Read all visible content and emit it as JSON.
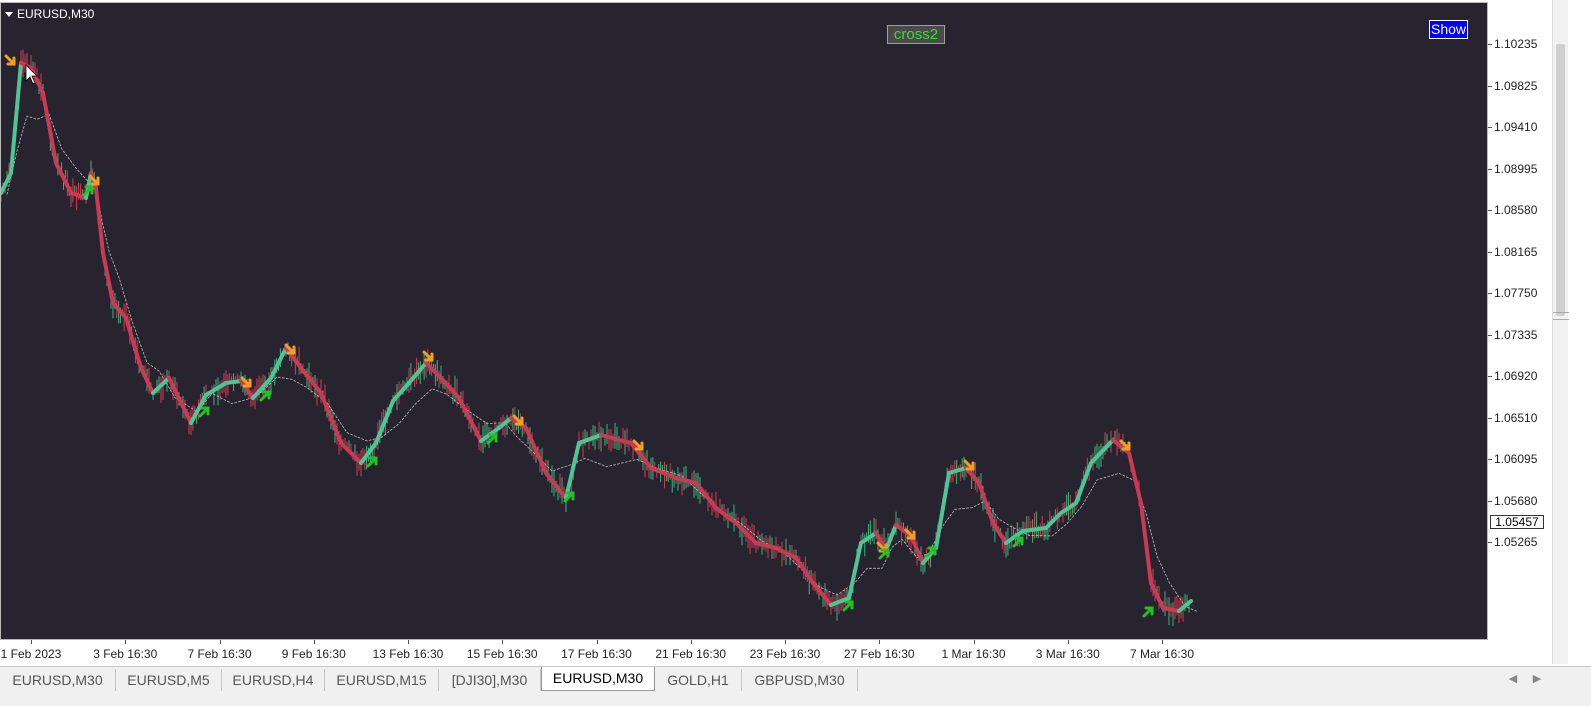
{
  "chart": {
    "symbol_title": "EURUSD,M30",
    "indicator_label": "cross2",
    "show_button": "Show",
    "current_price": "1.05457",
    "price_labels": [
      "1.10235",
      "1.09825",
      "1.09410",
      "1.08995",
      "1.08580",
      "1.08165",
      "1.07750",
      "1.07335",
      "1.06920",
      "1.06510",
      "1.06095",
      "1.05680",
      "1.05265"
    ],
    "time_labels": [
      "1 Feb 2023",
      "3 Feb 16:30",
      "7 Feb 16:30",
      "9 Feb 16:30",
      "13 Feb 16:30",
      "15 Feb 16:30",
      "17 Feb 16:30",
      "21 Feb 16:30",
      "23 Feb 16:30",
      "27 Feb 16:30",
      "1 Mar 16:30",
      "3 Mar 16:30",
      "7 Mar 16:30"
    ]
  },
  "colors": {
    "background": "#28242f",
    "up_candle": "#3ab37a",
    "down_candle": "#d23c50",
    "ma_up": "#4fc497",
    "ma_down": "#c93a55",
    "sell_arrow": "#f0a020",
    "buy_arrow": "#22c222"
  },
  "tabs": [
    {
      "label": "EURUSD,M30",
      "active": false
    },
    {
      "label": "EURUSD,M5",
      "active": false
    },
    {
      "label": "EURUSD,H4",
      "active": false
    },
    {
      "label": "EURUSD,M15",
      "active": false
    },
    {
      "label": "[DJI30],M30",
      "active": false
    },
    {
      "label": "EURUSD,M30",
      "active": true
    },
    {
      "label": "GOLD,H1",
      "active": false
    },
    {
      "label": "GBPUSD,M30",
      "active": false
    }
  ],
  "icons": {
    "title_menu": "triangle-down-icon",
    "mouse_cursor": "arrow-cursor-icon",
    "tab_prev": "tab-left-arrow-icon",
    "tab_next": "tab-right-arrow-icon"
  },
  "signals": [
    {
      "type": "sell",
      "time": "1 Feb 2023",
      "price": 1.1018
    },
    {
      "type": "buy",
      "time": "3 Feb 16:30",
      "price": 1.0898
    },
    {
      "type": "sell",
      "time": "3 Feb 16:30",
      "price": 1.0905
    },
    {
      "type": "buy",
      "time": "7 Feb 16:30",
      "price": 1.0727
    },
    {
      "type": "sell",
      "time": "7 Feb 16:30",
      "price": 1.0736
    },
    {
      "type": "buy",
      "time": "9 Feb 16:30",
      "price": 1.073
    },
    {
      "type": "sell",
      "time": "9 Feb 16:30",
      "price": 1.0765
    },
    {
      "type": "buy",
      "time": "13 Feb 16:30",
      "price": 1.0663
    },
    {
      "type": "sell",
      "time": "13 Feb 16:30",
      "price": 1.076
    },
    {
      "type": "buy",
      "time": "15 Feb 16:30",
      "price": 1.069
    },
    {
      "type": "sell",
      "time": "15 Feb 16:30",
      "price": 1.0704
    },
    {
      "type": "buy",
      "time": "17 Feb 16:30",
      "price": 1.0644
    },
    {
      "type": "sell",
      "time": "17 Feb 16:30",
      "price": 1.068
    },
    {
      "type": "buy",
      "time": "27 Feb 16:30",
      "price": 1.0545
    },
    {
      "type": "sell",
      "time": "27 Feb 16:30",
      "price": 1.0596
    },
    {
      "type": "buy",
      "time": "27 Feb 16:30",
      "price": 1.0587
    },
    {
      "type": "sell",
      "time": "27 Feb 16:30",
      "price": 1.0606
    },
    {
      "type": "buy",
      "time": "1 Mar 16:30",
      "price": 1.0589
    },
    {
      "type": "sell",
      "time": "1 Mar 16:30",
      "price": 1.067
    },
    {
      "type": "buy",
      "time": "1 Mar 16:30",
      "price": 1.06
    },
    {
      "type": "sell",
      "time": "7 Mar 16:30",
      "price": 1.0682
    },
    {
      "type": "buy",
      "time": "7 Mar 16:30",
      "price": 1.0538
    }
  ]
}
